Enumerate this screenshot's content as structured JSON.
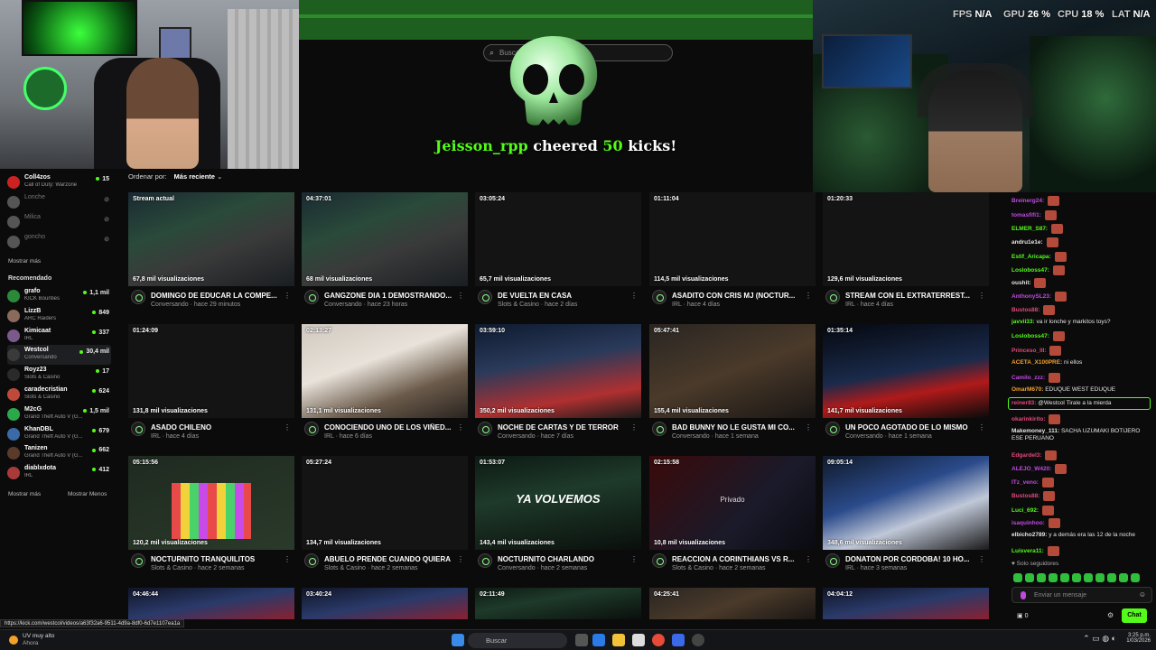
{
  "hud": {
    "fps_label": "FPS",
    "fps_value": "N/A",
    "gpu_label": "GPU",
    "gpu_value": "26 %",
    "cpu_label": "CPU",
    "cpu_value": "18 %",
    "lat_label": "LAT",
    "lat_value": "N/A"
  },
  "search": {
    "placeholder": "Buscar"
  },
  "cheer": {
    "user": "Jeisson_rpp",
    "middle": " cheered ",
    "amount": "50",
    "suffix": " kicks!"
  },
  "sidebar": {
    "following": [
      {
        "name": "Coll4zos",
        "sub": "Call of Duty: Warzone",
        "viewers": "15",
        "color": "#c22"
      },
      {
        "name": "Lonche",
        "sub": "",
        "viewers": "⊘",
        "color": "#555",
        "offline": true
      },
      {
        "name": "Milica",
        "sub": "",
        "viewers": "⊘",
        "color": "#555",
        "offline": true
      },
      {
        "name": "goncho",
        "sub": "",
        "viewers": "⊘",
        "color": "#555",
        "offline": true
      }
    ],
    "show_more": "Mostrar más",
    "recommended_title": "Recomendado",
    "recommended": [
      {
        "name": "grafo",
        "sub": "KICK Bounties",
        "viewers": "1,1 mil",
        "color": "#2a8a3a"
      },
      {
        "name": "LizzB",
        "sub": "ARC Raiders",
        "viewers": "849",
        "color": "#8a6a5a"
      },
      {
        "name": "Kimicaat",
        "sub": "IRL",
        "viewers": "337",
        "color": "#7a5a8a"
      },
      {
        "name": "Westcol",
        "sub": "Conversando",
        "viewers": "30,4 mil",
        "color": "#3a3a3a",
        "selected": true
      },
      {
        "name": "Royz23",
        "sub": "Slots & Casino",
        "viewers": "17",
        "color": "#2a2a2a"
      },
      {
        "name": "caradecristian",
        "sub": "Slots & Casino",
        "viewers": "624",
        "color": "#c04a3a"
      },
      {
        "name": "M2cG",
        "sub": "Grand Theft Auto V (G...",
        "viewers": "1,5 mil",
        "color": "#2aa84a"
      },
      {
        "name": "KhanDBL",
        "sub": "Grand Theft Auto V (G...",
        "viewers": "679",
        "color": "#3a6aa8"
      },
      {
        "name": "Tanizen",
        "sub": "Grand Theft Auto V (G...",
        "viewers": "662",
        "color": "#5a3a2a"
      },
      {
        "name": "diablxdota",
        "sub": "IRL",
        "viewers": "412",
        "color": "#aa3a3a"
      }
    ],
    "show_more2": "Mostrar más",
    "show_less": "Mostrar Menos"
  },
  "sort": {
    "label": "Ordenar por:",
    "value": "Más reciente"
  },
  "videos": [
    {
      "dur": "Stream actual",
      "views": "67,8 mil visualizaciones",
      "title": "DOMINGO DE EDUCAR LA COMPE...",
      "meta": "Conversando · hace 29 minutos",
      "thumb": "th-a"
    },
    {
      "dur": "04:37:01",
      "views": "68 mil visualizaciones",
      "title": "GANGZONE DIA 1 DEMOSTRANDO...",
      "meta": "Conversando · hace 23 horas",
      "thumb": "th-a"
    },
    {
      "dur": "03:05:24",
      "views": "65,7 mil visualizaciones",
      "title": "DE VUELTA EN CASA",
      "meta": "Slots & Casino · hace 2 días",
      "thumb": ""
    },
    {
      "dur": "01:11:04",
      "views": "114,5 mil visualizaciones",
      "title": "ASADITO CON CRIS MJ (NOCTUR...",
      "meta": "IRL · hace 4 días",
      "thumb": ""
    },
    {
      "dur": "01:20:33",
      "views": "129,6 mil visualizaciones",
      "title": "STREAM CON EL EXTRATERREST...",
      "meta": "IRL · hace 4 días",
      "thumb": ""
    },
    {
      "dur": "01:24:09",
      "views": "131,8 mil visualizaciones",
      "title": "ASADO CHILENO",
      "meta": "IRL · hace 4 días",
      "thumb": ""
    },
    {
      "dur": "02:13:27",
      "views": "131,1 mil visualizaciones",
      "title": "CONOCIENDO UNO DE LOS VIÑED...",
      "meta": "IRL · hace 6 días",
      "thumb": "th-b"
    },
    {
      "dur": "03:59:10",
      "views": "350,2 mil visualizaciones",
      "title": "NOCHE DE CARTAS Y DE TERROR",
      "meta": "Conversando · hace 7 días",
      "thumb": "th-c"
    },
    {
      "dur": "05:47:41",
      "views": "155,4 mil visualizaciones",
      "title": "BAD BUNNY NO LE GUSTA MI CO...",
      "meta": "Conversando · hace 1 semana",
      "thumb": "th-d"
    },
    {
      "dur": "01:35:14",
      "views": "141,7 mil visualizaciones",
      "title": "UN POCO AGOTADO DE LO MISMO",
      "meta": "Conversando · hace 1 semana",
      "thumb": "th-e"
    },
    {
      "dur": "05:15:56",
      "views": "120,2 mil visualizaciones",
      "title": "NOCTURNITO TRANQUILITOS",
      "meta": "Slots & Casino · hace 2 semanas",
      "thumb": "th-f",
      "slots": true
    },
    {
      "dur": "05:27:24",
      "views": "134,7 mil visualizaciones",
      "title": "ABUELO PRENDE CUANDO QUIERA",
      "meta": "Slots & Casino · hace 2 semanas",
      "thumb": ""
    },
    {
      "dur": "01:53:07",
      "views": "143,4 mil visualizaciones",
      "title": "NOCTURNITO CHARLANDO",
      "meta": "Conversando · hace 2 semanas",
      "thumb": "th-g",
      "big": "YA VOLVEMOS"
    },
    {
      "dur": "02:15:58",
      "views": "10,8 mil visualizaciones",
      "title": "REACCION A CORINTHIANS VS R...",
      "meta": "Slots & Casino · hace 2 semanas",
      "thumb": "th-h",
      "mid": "Privado"
    },
    {
      "dur": "09:05:14",
      "views": "348,6 mil visualizaciones",
      "title": "DONATON POR CORDOBA! 10 HO...",
      "meta": "IRL · hace 3 semanas",
      "thumb": "th-i"
    },
    {
      "dur": "04:46:44",
      "views": "",
      "title": "",
      "meta": "",
      "thumb": "th-j"
    },
    {
      "dur": "03:40:24",
      "views": "",
      "title": "",
      "meta": "",
      "thumb": "th-j"
    },
    {
      "dur": "02:11:49",
      "views": "",
      "title": "",
      "meta": "",
      "thumb": "th-g"
    },
    {
      "dur": "04:25:41",
      "views": "",
      "title": "",
      "meta": "",
      "thumb": "th-d"
    },
    {
      "dur": "04:04:12",
      "views": "",
      "title": "",
      "meta": "",
      "thumb": "th-j"
    }
  ],
  "chat": {
    "messages": [
      {
        "user": "Breinerg24:",
        "text": "",
        "color": "#c04adf",
        "emote": true
      },
      {
        "user": "tomasfifi1:",
        "text": "",
        "color": "#c04adf",
        "emote": true
      },
      {
        "user": "ELMER_S87:",
        "text": "",
        "color": "#53fc18",
        "emote": true
      },
      {
        "user": "andru1e1e:",
        "text": "",
        "color": "#e6e6e6",
        "emote": true
      },
      {
        "user": "Estif_Aricapa:",
        "text": "",
        "color": "#53fc18",
        "emote": true
      },
      {
        "user": "Losloboss47:",
        "text": "",
        "color": "#53fc18",
        "emote": true
      },
      {
        "user": "oushit:",
        "text": "",
        "color": "#e6e6e6",
        "emote": true
      },
      {
        "user": "AnthonySL23:",
        "text": "",
        "color": "#c04adf",
        "emote": true
      },
      {
        "user": "Bustos88:",
        "text": "",
        "color": "#e04a7a",
        "emote": true
      },
      {
        "user": "javvii33:",
        "text": "va ir lonche y markitos toys?",
        "color": "#53fc18"
      },
      {
        "user": "Losloboss47:",
        "text": "",
        "color": "#53fc18",
        "emote": true
      },
      {
        "user": "Princeso_lll:",
        "text": "",
        "color": "#e04a7a",
        "emote": true
      },
      {
        "user": "ACETA_X100PRE:",
        "text": "ni ellos",
        "color": "#f2a12a"
      },
      {
        "user": "Camilo_zzz:",
        "text": "",
        "color": "#c04adf",
        "emote": true
      },
      {
        "user": "OmarM670:",
        "text": "EDUQUE WEST EDUQUE",
        "color": "#f2a12a"
      },
      {
        "user": "reiner83:",
        "text": "@Westcol Tirale a la mierda",
        "color": "#e04a7a"
      },
      {
        "user": "okarinkirito:",
        "text": "",
        "color": "#e04a7a",
        "emote": true
      },
      {
        "user": "Makemoney_111:",
        "text": "SACHA UZUMAKI BOTIJERO ESE PERUANO",
        "color": "#e6e6e6"
      },
      {
        "user": "Edgardel3:",
        "text": "",
        "color": "#e04a7a",
        "emote": true
      },
      {
        "user": "ALEJO_W420:",
        "text": "",
        "color": "#c04adf",
        "emote": true
      },
      {
        "user": "ITz_veno:",
        "text": "",
        "color": "#c04adf",
        "emote": true
      },
      {
        "user": "Bustos88:",
        "text": "",
        "color": "#e04a7a",
        "emote": true
      },
      {
        "user": "Luci_692:",
        "text": "",
        "color": "#53fc18",
        "emote": true
      },
      {
        "user": "isaquinhoo:",
        "text": "",
        "color": "#c04adf",
        "emote": true
      },
      {
        "user": "elbicho2789:",
        "text": "y a demás era las 12 de la noche",
        "color": "#e6e6e6"
      },
      {
        "user": "Luisvera11:",
        "text": "",
        "color": "#53fc18",
        "emote": true
      }
    ],
    "followers_only": "Solo seguidores",
    "input_placeholder": "Enviar un mensaje",
    "send": "Chat",
    "points": "0"
  },
  "status_url": "https://kick.com/westcol/videos/a63f32a6-9511-4d9a-8df0-6d7e1107ea1a",
  "taskbar": {
    "weather_title": "UV muy alto",
    "weather_sub": "Ahora",
    "search": "Buscar",
    "time": "3:25 p.m.",
    "date": "1/03/2026"
  }
}
